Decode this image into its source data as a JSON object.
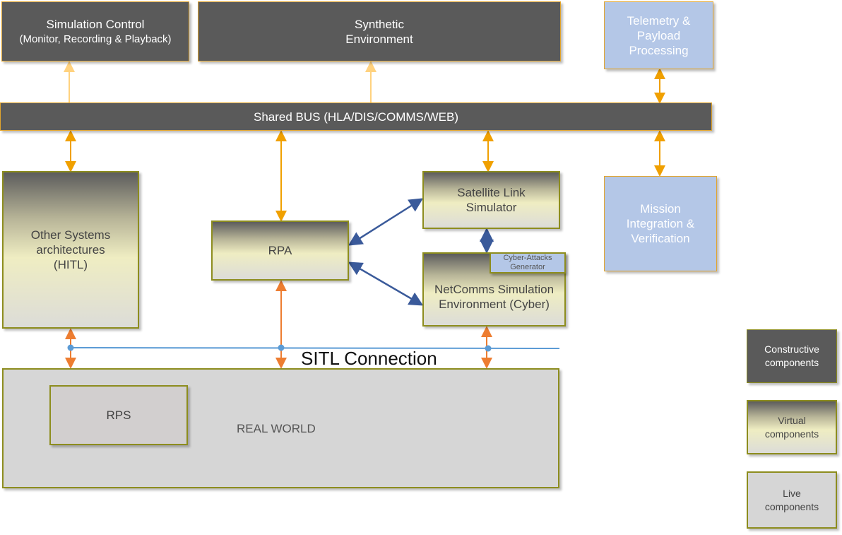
{
  "boxes": {
    "simulation_control": {
      "line1": "Simulation  Control",
      "line2": "(Monitor, Recording & Playback)"
    },
    "synthetic_environment": {
      "line1": "Synthetic",
      "line2": "Environment"
    },
    "telemetry": {
      "line1": "Telemetry &",
      "line2": "Payload",
      "line3": "Processing"
    },
    "shared_bus": "Shared BUS (HLA/DIS/COMMS/WEB)",
    "other_systems": {
      "line1": "Other Systems",
      "line2": "architectures",
      "line3": "(HITL)"
    },
    "rpa": "RPA",
    "satellite_link": {
      "line1": "Satellite  Link",
      "line2": "Simulator"
    },
    "netcomms": {
      "line1": "NetComms Simulation",
      "line2": "Environment  (Cyber)"
    },
    "cyber_attacks": {
      "line1": "Cyber-Attacks",
      "line2": "Generator"
    },
    "mission": {
      "line1": "Mission",
      "line2": "Integration &",
      "line3": "Verification"
    },
    "real_world": "REAL WORLD",
    "rps": "RPS"
  },
  "sitl_label": "SITL Connection",
  "legend": [
    {
      "line1": "Constructive",
      "line2": "components"
    },
    {
      "line1": "Virtual",
      "line2": "components"
    },
    {
      "line1": "Live",
      "line2": "components"
    }
  ],
  "colors": {
    "constructive": "#5a5a5a",
    "live": "#d6d6d6",
    "external": "#b4c7e7",
    "bus_arrow": "#f0a000",
    "light_arrow": "#ffd27f",
    "live_arrow": "#ed7d31",
    "cyber_arrow": "#3a5a9a",
    "sitl_line": "#5b9bd5"
  }
}
